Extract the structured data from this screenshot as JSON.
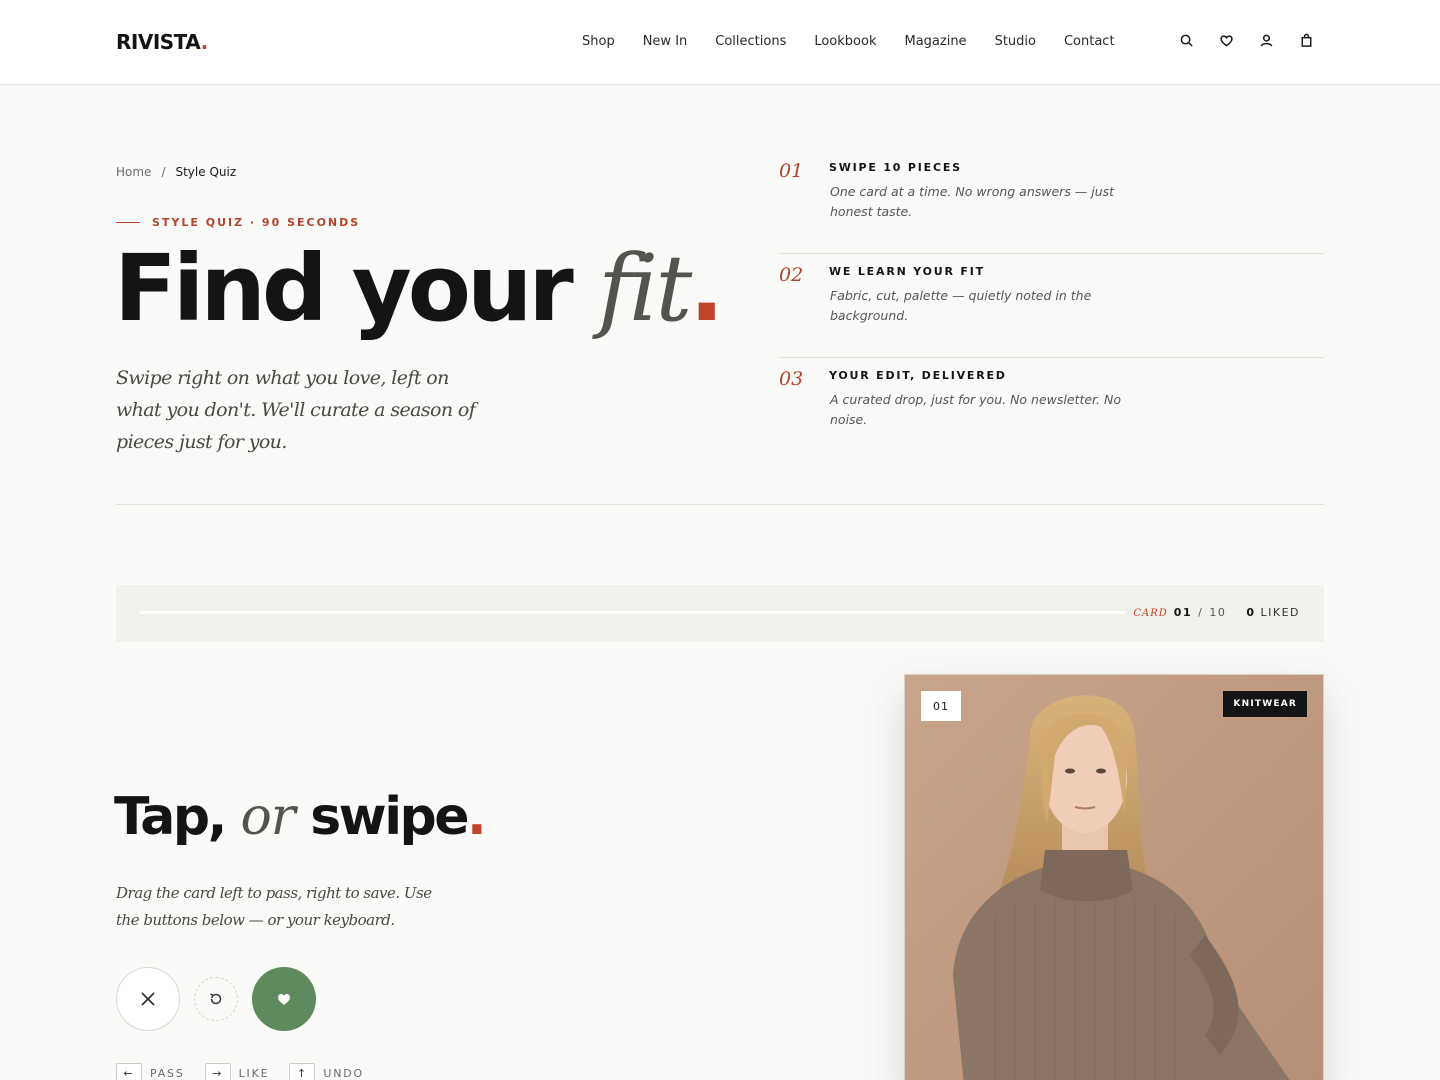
{
  "brand": {
    "name": "RIVISTA",
    "dot": "."
  },
  "nav": [
    {
      "label": "Shop"
    },
    {
      "label": "New In"
    },
    {
      "label": "Collections"
    },
    {
      "label": "Lookbook"
    },
    {
      "label": "Magazine"
    },
    {
      "label": "Studio"
    },
    {
      "label": "Contact"
    }
  ],
  "header_icons": [
    "search-icon",
    "heart-icon",
    "user-icon",
    "bag-icon"
  ],
  "breadcrumb": {
    "home": "Home",
    "sep": "/",
    "current": "Style Quiz"
  },
  "hero": {
    "eyebrow": "STYLE QUIZ · 90 SECONDS",
    "title_main": "Find your ",
    "title_italic": "fit",
    "title_dot": ".",
    "subtitle": "Swipe right on what you love, left on what you don't. We'll curate a season of pieces just for you."
  },
  "steps": [
    {
      "num": "01",
      "title": "SWIPE 10 PIECES",
      "desc": "One card at a time. No wrong answers — just honest taste."
    },
    {
      "num": "02",
      "title": "WE LEARN YOUR FIT",
      "desc": "Fabric, cut, palette — quietly noted in the background."
    },
    {
      "num": "03",
      "title": "YOUR EDIT, DELIVERED",
      "desc": "A curated drop, just for you. No newsletter. No noise."
    }
  ],
  "progress": {
    "label": "CARD",
    "current": "01",
    "separator": "/",
    "total": "10",
    "liked_count": "0",
    "liked_label": "LIKED",
    "fraction": 0.0
  },
  "tap": {
    "title_a": "Tap, ",
    "title_italic": "or",
    "title_b": " swipe",
    "title_dot": ".",
    "subtitle": "Drag the card left to pass, right to save. Use the buttons below — or your keyboard."
  },
  "actions": {
    "pass_icon": "close-icon",
    "undo_icon": "undo-icon",
    "like_icon": "heart-icon"
  },
  "keys": [
    {
      "key": "←",
      "label": "PASS"
    },
    {
      "key": "→",
      "label": "LIKE"
    },
    {
      "key": "↑",
      "label": "UNDO"
    }
  ],
  "card": {
    "number": "01",
    "tag": "KNITWEAR"
  },
  "colors": {
    "accent": "#c0432a",
    "like": "#5e8b5e",
    "background": "#fafaf9",
    "card_backdrop": "#c09a80",
    "sweater": "#8a7567"
  }
}
